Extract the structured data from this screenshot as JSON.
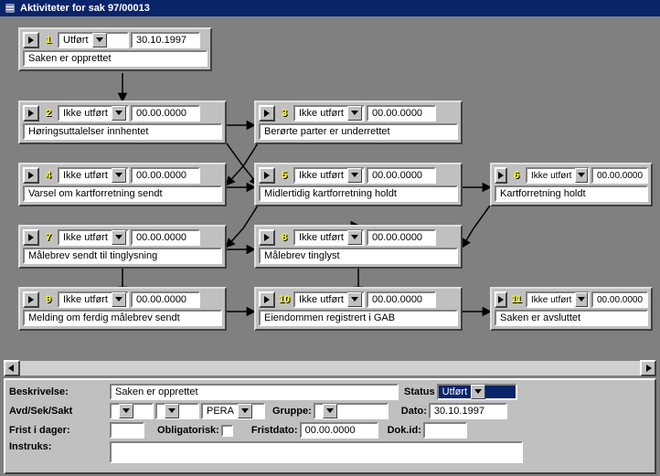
{
  "window": {
    "title": "Aktiviteter for sak 97/00013"
  },
  "status_options": {
    "done": "Utført",
    "not_done": "Ikke utført"
  },
  "nodes": [
    {
      "id": "1",
      "status": "Utført",
      "date": "30.10.1997",
      "desc": "Saken er opprettet"
    },
    {
      "id": "2",
      "status": "Ikke utført",
      "date": "00.00.0000",
      "desc": "Høringsuttalelser innhentet"
    },
    {
      "id": "3",
      "status": "Ikke utført",
      "date": "00.00.0000",
      "desc": "Berørte parter er underrettet"
    },
    {
      "id": "4",
      "status": "Ikke utført",
      "date": "00.00.0000",
      "desc": "Varsel om kartforretning sendt"
    },
    {
      "id": "5",
      "status": "Ikke utført",
      "date": "00.00.0000",
      "desc": "Midlertidig kartforretning holdt"
    },
    {
      "id": "6",
      "status": "Ikke utført",
      "date": "00.00.0000",
      "desc": "Kartforretning holdt"
    },
    {
      "id": "7",
      "status": "Ikke utført",
      "date": "00.00.0000",
      "desc": "Målebrev sendt til tinglysning"
    },
    {
      "id": "8",
      "status": "Ikke utført",
      "date": "00.00.0000",
      "desc": "Målebrev tinglyst"
    },
    {
      "id": "9",
      "status": "Ikke utført",
      "date": "00.00.0000",
      "desc": "Melding om ferdig målebrev sendt"
    },
    {
      "id": "10",
      "status": "Ikke utført",
      "date": "00.00.0000",
      "desc": "Eiendommen registrert i GAB"
    },
    {
      "id": "11",
      "status": "Ikke utført",
      "date": "00.00.0000",
      "desc": "Saken er avsluttet"
    }
  ],
  "form": {
    "labels": {
      "beskrivelse": "Beskrivelse:",
      "avd": "Avd/Sek/Sakt",
      "gruppe": "Gruppe:",
      "frist": "Frist i dager:",
      "oblig": "Obligatorisk:",
      "fristdato": "Fristdato:",
      "status": "Status",
      "dato": "Dato:",
      "dokid": "Dok.id:",
      "instruks": "Instruks:"
    },
    "values": {
      "beskrivelse": "Saken er opprettet",
      "avd1": "",
      "avd2": "",
      "avd3": "PERA",
      "gruppe": "",
      "frist": "",
      "fristdato": "00.00.0000",
      "status": "Utført",
      "dato": "30.10.1997",
      "dokid": ""
    }
  }
}
